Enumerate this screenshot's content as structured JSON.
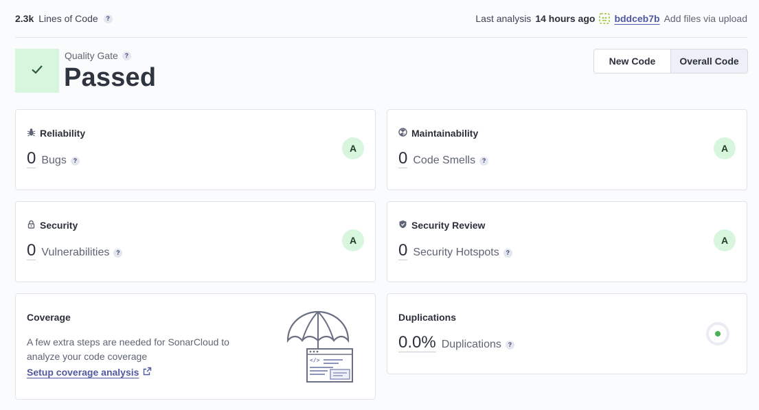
{
  "header": {
    "lines_of_code_value": "2.3k",
    "lines_of_code_label": "Lines of Code",
    "help_glyph": "?",
    "last_analysis_label": "Last analysis",
    "last_analysis_time": "14 hours ago",
    "commit_hash": "bddceb7b",
    "commit_message": "Add files via upload"
  },
  "quality_gate": {
    "label": "Quality Gate",
    "status": "Passed",
    "status_color": "#d8f5dd"
  },
  "toggle": {
    "options": [
      "New Code",
      "Overall Code"
    ],
    "selected": "Overall Code"
  },
  "cards": {
    "reliability": {
      "title": "Reliability",
      "value": "0",
      "label": "Bugs",
      "rating": "A",
      "icon": "bug-icon"
    },
    "maintainability": {
      "title": "Maintainability",
      "value": "0",
      "label": "Code Smells",
      "rating": "A",
      "icon": "code-smell-icon"
    },
    "security": {
      "title": "Security",
      "value": "0",
      "label": "Vulnerabilities",
      "rating": "A",
      "icon": "lock-icon"
    },
    "security_review": {
      "title": "Security Review",
      "value": "0",
      "label": "Security Hotspots",
      "rating": "A",
      "icon": "shield-icon"
    },
    "coverage": {
      "title": "Coverage",
      "text": "A few extra steps are needed for SonarCloud to analyze your code coverage",
      "link": "Setup coverage analysis",
      "illustration": "umbrella-illustration"
    },
    "duplications": {
      "title": "Duplications",
      "value": "0.0%",
      "label": "Duplications",
      "icon": "duplication-circle-icon"
    }
  },
  "colors": {
    "accent": "#5058a0",
    "rating_green": "#d8f5dd",
    "good_dot": "#4caf50"
  }
}
